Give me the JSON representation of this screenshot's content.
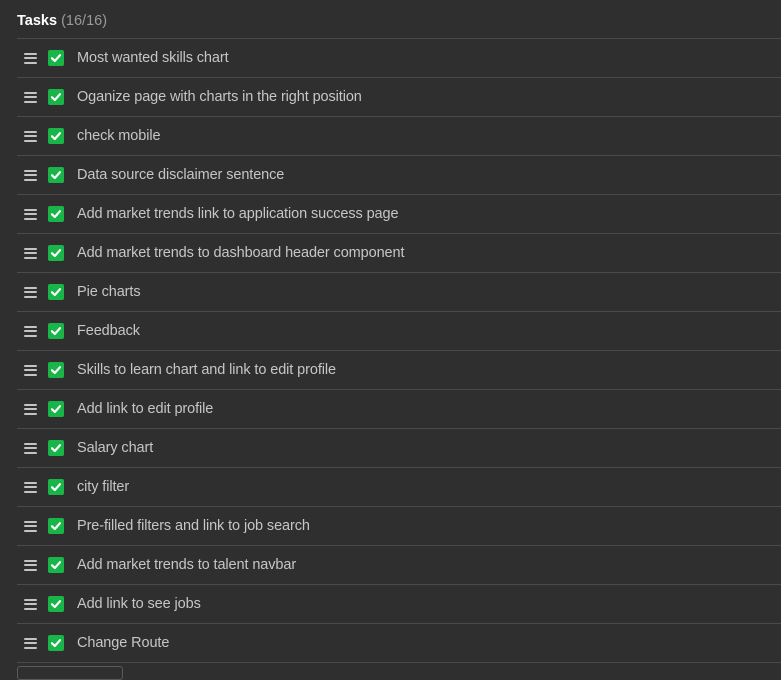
{
  "header": {
    "title": "Tasks",
    "count": "(16/16)"
  },
  "colors": {
    "background": "#2f2f2f",
    "checkbox": "#19b548",
    "divider": "#4a4a4a",
    "text": "#c6c6c6"
  },
  "icons": {
    "handle": "drag-handle-icon",
    "checkbox": "checkbox-checked-icon"
  },
  "tasks": [
    {
      "label": "Most wanted skills chart",
      "checked": true
    },
    {
      "label": "Oganize page with charts in the right position",
      "checked": true
    },
    {
      "label": "check mobile",
      "checked": true
    },
    {
      "label": "Data source disclaimer sentence",
      "checked": true
    },
    {
      "label": "Add market trends link to application success page",
      "checked": true
    },
    {
      "label": "Add market trends to dashboard header component",
      "checked": true
    },
    {
      "label": "Pie charts",
      "checked": true
    },
    {
      "label": "Feedback",
      "checked": true
    },
    {
      "label": "Skills to learn chart and link to edit profile",
      "checked": true
    },
    {
      "label": "Add link to edit profile",
      "checked": true
    },
    {
      "label": "Salary chart",
      "checked": true
    },
    {
      "label": "city filter",
      "checked": true
    },
    {
      "label": "Pre-filled filters and link to job search",
      "checked": true
    },
    {
      "label": "Add market trends to talent navbar",
      "checked": true
    },
    {
      "label": "Add link to see jobs",
      "checked": true
    },
    {
      "label": "Change Route",
      "checked": true
    }
  ]
}
